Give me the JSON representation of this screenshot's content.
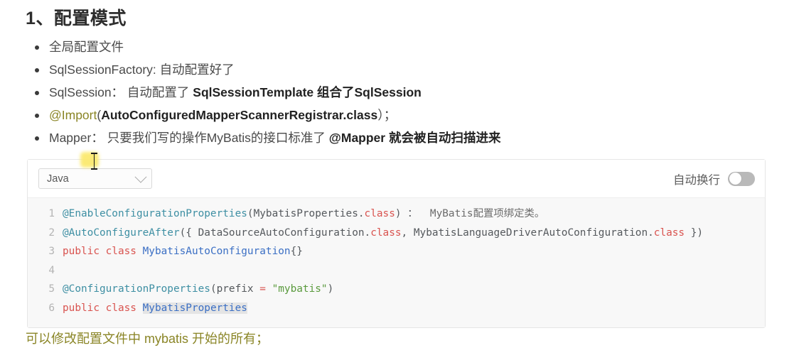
{
  "heading": "1、配置模式",
  "bullets": [
    {
      "id": "global-config-file",
      "segments": [
        {
          "text": "全局配置文件",
          "style": "normal"
        }
      ]
    },
    {
      "id": "sqlsessionfactory",
      "segments": [
        {
          "text": "SqlSessionFactory: 自动配置好了",
          "style": "normal"
        }
      ]
    },
    {
      "id": "sqlsession",
      "segments": [
        {
          "text": "SqlSession： 自动配置了 ",
          "style": "normal"
        },
        {
          "text": "SqlSessionTemplate 组合了SqlSession",
          "style": "bold"
        }
      ]
    },
    {
      "id": "import-annotation",
      "segments": [
        {
          "text": "@Import",
          "style": "olive"
        },
        {
          "text": "(",
          "style": "normal"
        },
        {
          "text": "AutoConfiguredMapperScannerRegistrar.class",
          "style": "bold"
        },
        {
          "text": "）；",
          "style": "normal"
        }
      ]
    },
    {
      "id": "mapper",
      "segments": [
        {
          "text": "Mapper： 只要我们写的操作MyBatis的接口标准了 ",
          "style": "normal"
        },
        {
          "text": "@Mapper 就会被自动扫描进来",
          "style": "bold"
        }
      ]
    }
  ],
  "code_block": {
    "language_label": "Java",
    "language_chevron_icon": "chevron-down-icon",
    "wrap_label": "自动换行",
    "wrap_enabled": false,
    "lines": [
      {
        "num": "1",
        "tokens": [
          {
            "t": "@EnableConfigurationProperties",
            "c": "ann"
          },
          {
            "t": "(MybatisProperties.",
            "c": "plain"
          },
          {
            "t": "class",
            "c": "kw"
          },
          {
            "t": ") ：  ",
            "c": "plain"
          },
          {
            "t": "MyBatis配置项绑定类。",
            "c": "cmt"
          }
        ]
      },
      {
        "num": "2",
        "tokens": [
          {
            "t": "@AutoConfigureAfter",
            "c": "ann"
          },
          {
            "t": "({ DataSourceAutoConfiguration.",
            "c": "plain"
          },
          {
            "t": "class",
            "c": "kw"
          },
          {
            "t": ", MybatisLanguageDriverAutoConfiguration.",
            "c": "plain"
          },
          {
            "t": "class",
            "c": "kw"
          },
          {
            "t": " })",
            "c": "plain"
          }
        ]
      },
      {
        "num": "3",
        "tokens": [
          {
            "t": "public class ",
            "c": "kw"
          },
          {
            "t": "MybatisAutoConfiguration",
            "c": "type"
          },
          {
            "t": "{}",
            "c": "plain"
          }
        ]
      },
      {
        "num": "4",
        "tokens": []
      },
      {
        "num": "5",
        "tokens": [
          {
            "t": "@ConfigurationProperties",
            "c": "ann"
          },
          {
            "t": "(prefix ",
            "c": "plain"
          },
          {
            "t": "=",
            "c": "kw"
          },
          {
            "t": " ",
            "c": "plain"
          },
          {
            "t": "\"mybatis\"",
            "c": "str"
          },
          {
            "t": ")",
            "c": "plain"
          }
        ]
      },
      {
        "num": "6",
        "tokens": [
          {
            "t": "public class ",
            "c": "kw"
          },
          {
            "t": "MybatisProperties",
            "c": "type",
            "selected": true
          }
        ]
      }
    ]
  },
  "note": "可以修改配置文件中 mybatis 开始的所有；",
  "cursor": {
    "icon": "text-ibeam-cursor",
    "highlight_color": "#fbe96b"
  },
  "colors": {
    "olive_text": "#8a8526",
    "code_bg": "#f8f8f8",
    "annotation": "#3e8fa3",
    "keyword": "#d9534f",
    "type": "#3b6fc4",
    "string": "#5a9a3d"
  }
}
